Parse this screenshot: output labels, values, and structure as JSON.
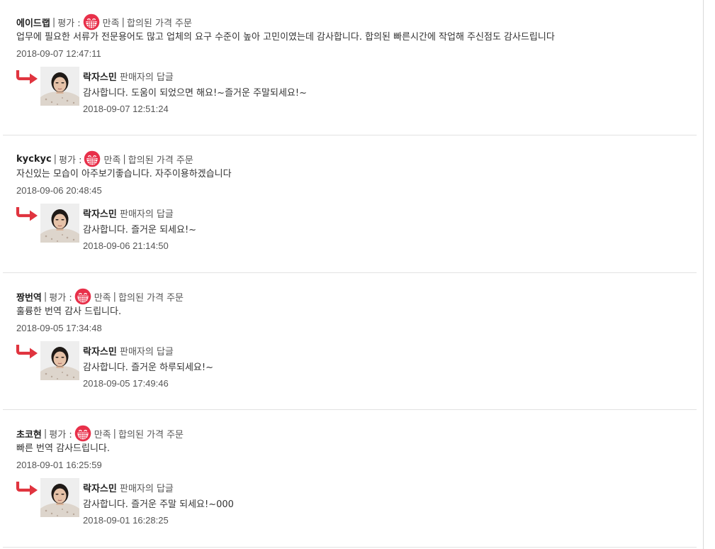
{
  "labels": {
    "rating_prefix": "평가 :",
    "reply_suffix": "판매자의 답글",
    "separator": "|"
  },
  "seller_name": "락자스민",
  "colors": {
    "face_red": "#e8304a",
    "arrow_red": "#e0343f",
    "divider": "#e2e2e2"
  },
  "reviews": [
    {
      "author": "에이드랩",
      "rating": "만족",
      "order_type": "합의된 가격 주문",
      "comment": "업무에 필요한 서류가 전문용어도 많고 업체의 요구 수준이 높아 고민이였는데 감사합니다. 합의된 빠른시간에 작업해 주신점도 감사드립니다",
      "date": "2018-09-07 12:47:11",
      "reply_text": "감사합니다. 도움이 되었으면 해요!~즐거운 주말되세요!~",
      "reply_date": "2018-09-07 12:51:24"
    },
    {
      "author": "kyckyc",
      "rating": "만족",
      "order_type": "합의된 가격 주문",
      "comment": "자신있는 모습이 아주보기좋습니다. 자주이용하겠습니다",
      "date": "2018-09-06 20:48:45",
      "reply_text": "감사합니다. 즐거운 되세요!~",
      "reply_date": "2018-09-06 21:14:50"
    },
    {
      "author": "짱번역",
      "rating": "만족",
      "order_type": "합의된 가격 주문",
      "comment": "훌륭한 번역 감사 드립니다.",
      "date": "2018-09-05 17:34:48",
      "reply_text": "감사합니다. 즐거운 하루되세요!~",
      "reply_date": "2018-09-05 17:49:46"
    },
    {
      "author": "초코현",
      "rating": "만족",
      "order_type": "합의된 가격 주문",
      "comment": "빠른 번역 감사드립니다.",
      "date": "2018-09-01 16:25:59",
      "reply_text": "감사합니다. 즐거운 주말 되세요!~000",
      "reply_date": "2018-09-01 16:28:25"
    }
  ]
}
